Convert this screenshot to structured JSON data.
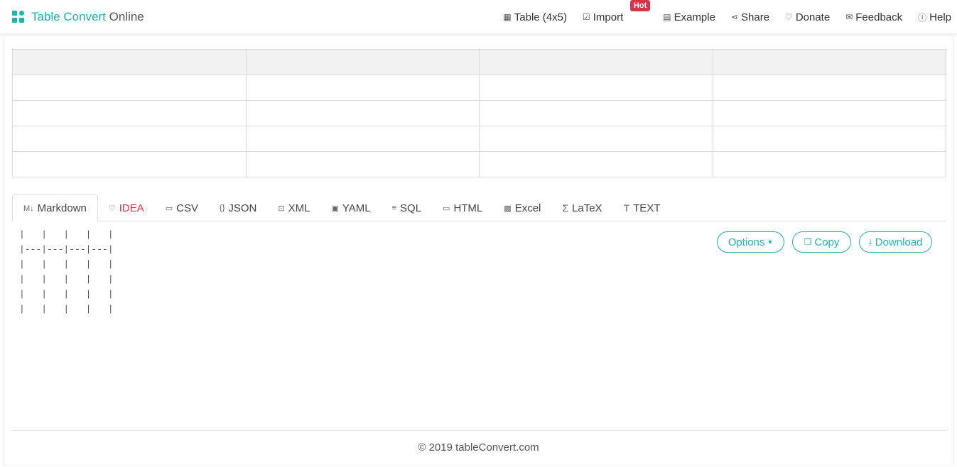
{
  "brand": {
    "name_accent": "Table Convert",
    "name_rest": "Online"
  },
  "nav": {
    "table": {
      "icon": "table-icon",
      "label": "Table (4x5)"
    },
    "import": {
      "icon": "import-icon",
      "label": "Import",
      "badge": "Hot"
    },
    "example": {
      "icon": "example-icon",
      "label": "Example"
    },
    "share": {
      "icon": "share-icon",
      "label": "Share"
    },
    "donate": {
      "icon": "donate-icon",
      "label": "Donate"
    },
    "feedback": {
      "icon": "mail-icon",
      "label": "Feedback"
    },
    "help": {
      "icon": "help-icon",
      "label": "Help"
    }
  },
  "table": {
    "columns": 4,
    "rows": [
      [
        "",
        "",
        "",
        ""
      ],
      [
        "",
        "",
        "",
        ""
      ],
      [
        "",
        "",
        "",
        ""
      ],
      [
        "",
        "",
        "",
        ""
      ],
      [
        "",
        "",
        "",
        ""
      ]
    ]
  },
  "tabs": [
    {
      "label": "Markdown",
      "icon": "markdown-icon",
      "active": true
    },
    {
      "label": "IDEA",
      "icon": "bulb-icon"
    },
    {
      "label": "CSV",
      "icon": "csv-icon"
    },
    {
      "label": "JSON",
      "icon": "json-icon"
    },
    {
      "label": "XML",
      "icon": "xml-icon"
    },
    {
      "label": "YAML",
      "icon": "yaml-icon"
    },
    {
      "label": "SQL",
      "icon": "database-icon"
    },
    {
      "label": "HTML",
      "icon": "html-icon"
    },
    {
      "label": "Excel",
      "icon": "excel-icon"
    },
    {
      "label": "LaTeX",
      "icon": "sigma-icon"
    },
    {
      "label": "TEXT",
      "icon": "text-icon"
    }
  ],
  "output": {
    "text": "|   |   |   |   |\n|---|---|---|---|\n|   |   |   |   |\n|   |   |   |   |\n|   |   |   |   |\n|   |   |   |   |"
  },
  "actions": {
    "options": "Options",
    "copy": "Copy",
    "download": "Download"
  },
  "footer": {
    "text": "© 2019 tableConvert.com"
  },
  "colors": {
    "accent": "#1fb3a9",
    "hot": "#d9334a"
  }
}
